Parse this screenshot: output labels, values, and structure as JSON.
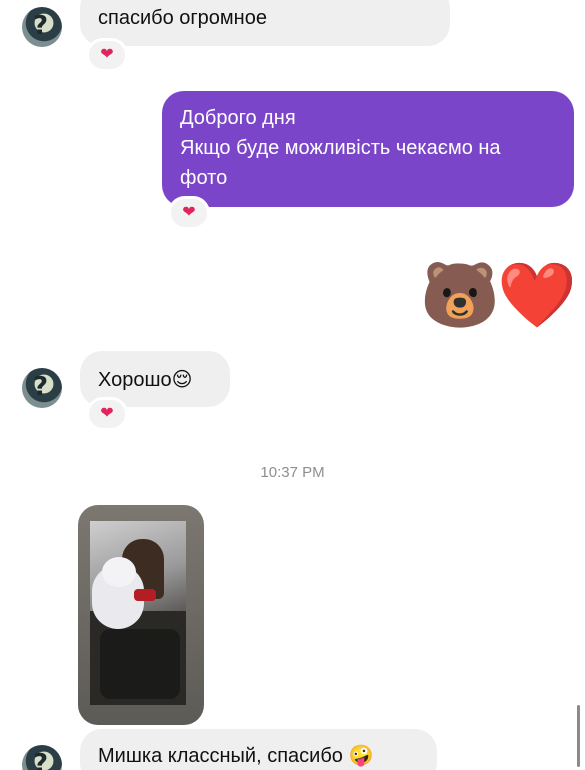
{
  "messages": {
    "m1": {
      "text": "спасибо огромное",
      "reaction": "❤"
    },
    "m2": {
      "line1": "Доброго дня",
      "line2": "Якщо буде можливість чекаємо на",
      "line3": "фото",
      "reaction": "❤"
    },
    "m3": {
      "emoji": [
        "🐻",
        "❤️"
      ]
    },
    "m4": {
      "text": "Хорошо",
      "emoji": "😌",
      "reaction": "❤"
    },
    "timestamp": "10:37 PM",
    "m6": {
      "text": "Мишка классный, спасибо",
      "emoji": "🤪"
    }
  },
  "colors": {
    "outgoing_bubble": "#7b45c9",
    "incoming_bubble": "#efefef",
    "reaction_heart": "#e0245e"
  },
  "icons": {
    "avatar": "contact-avatar",
    "reaction": "heart-reaction-icon"
  }
}
